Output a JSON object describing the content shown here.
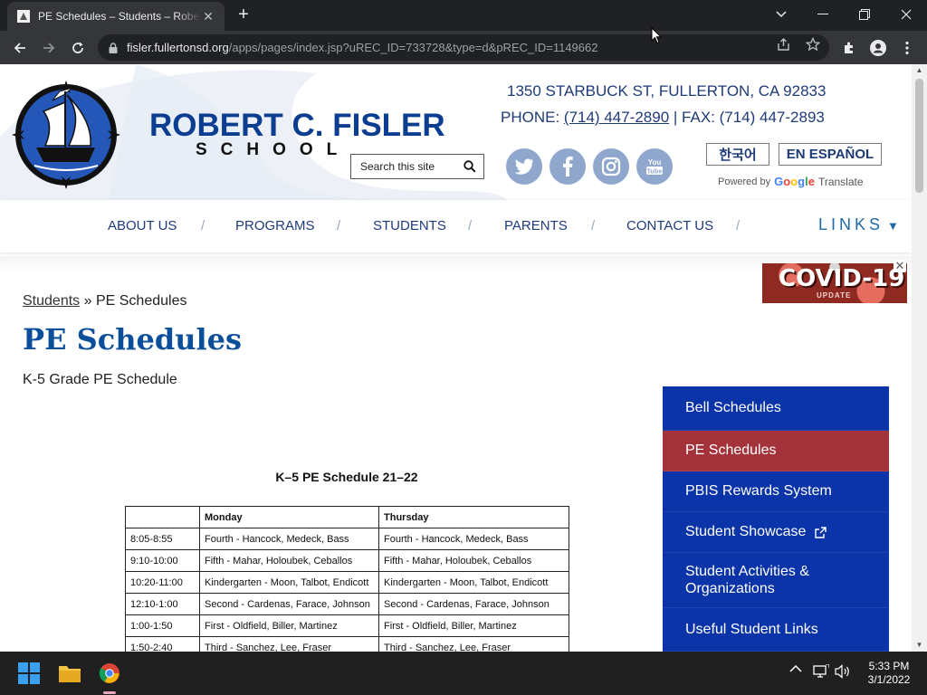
{
  "browser": {
    "tab_title": "PE Schedules – Students – Robert C. Fisler School",
    "new_tab": "+",
    "url_host": "fisler.fullertonsd.org",
    "url_path": "/apps/pages/index.jsp?uREC_ID=733728&type=d&pREC_ID=1149662"
  },
  "header": {
    "school_name": "ROBERT C. FISLER",
    "school_sub": "SCHOOL",
    "search_placeholder": "Search this site",
    "address": "1350 STARBUCK ST,  FULLERTON, CA 92833",
    "phone_label": "PHONE: ",
    "phone_number": "(714) 447-2890",
    "fax": " | FAX: (714) 447-2893",
    "lang_korean": "한국어",
    "lang_spanish": "EN ESPAÑOL",
    "powered_by": "Powered by",
    "translate": "Translate",
    "social": [
      "twitter-icon",
      "facebook-icon",
      "instagram-icon",
      "youtube-icon"
    ]
  },
  "nav": {
    "items": [
      "ABOUT US",
      "PROGRAMS",
      "STUDENTS",
      "PARENTS",
      "CONTACT US"
    ],
    "separator": "/",
    "links": "LINKS",
    "links_caret": "▼"
  },
  "covid": {
    "title": "COVID-19",
    "sub": "UPDATE",
    "close": "✕"
  },
  "content": {
    "breadcrumb_link": "Students",
    "breadcrumb_sep": " » ",
    "breadcrumb_current": "PE Schedules",
    "title": "PE Schedules",
    "subhead": "K-5 Grade PE Schedule",
    "schedule_title": "K–5 PE Schedule 21–22",
    "table_headers": [
      "",
      "Monday",
      "Thursday"
    ],
    "table_rows": [
      [
        "8:05-8:55",
        "Fourth - Hancock, Medeck, Bass",
        "Fourth - Hancock, Medeck, Bass"
      ],
      [
        "9:10-10:00",
        "Fifth - Mahar, Holoubek, Ceballos",
        "Fifth - Mahar, Holoubek, Ceballos"
      ],
      [
        "10:20-11:00",
        "Kindergarten - Moon, Talbot, Endicott",
        "Kindergarten - Moon, Talbot, Endicott"
      ],
      [
        "12:10-1:00",
        "Second - Cardenas, Farace, Johnson",
        "Second  - Cardenas, Farace, Johnson"
      ],
      [
        "1:00-1:50",
        "First - Oldfield, Biller, Martinez",
        "First - Oldfield, Biller, Martinez"
      ],
      [
        "1:50-2:40",
        "Third - Sanchez, Lee, Fraser",
        "Third  - Sanchez, Lee, Fraser"
      ]
    ]
  },
  "sidenav": {
    "items": [
      {
        "label": "Bell Schedules",
        "active": false,
        "external": false
      },
      {
        "label": "PE Schedules",
        "active": true,
        "external": false
      },
      {
        "label": "PBIS Rewards System",
        "active": false,
        "external": false
      },
      {
        "label": "Student Showcase",
        "active": false,
        "external": true
      },
      {
        "label": "Student Activities & Organizations",
        "active": false,
        "external": false
      },
      {
        "label": "Useful Student Links",
        "active": false,
        "external": false
      }
    ]
  },
  "taskbar": {
    "time": "5:33 PM",
    "date": "3/1/2022"
  },
  "colors": {
    "brand_blue": "#0b3d91",
    "sidenav_blue": "#0a34a7",
    "active_red": "#a4323a"
  }
}
